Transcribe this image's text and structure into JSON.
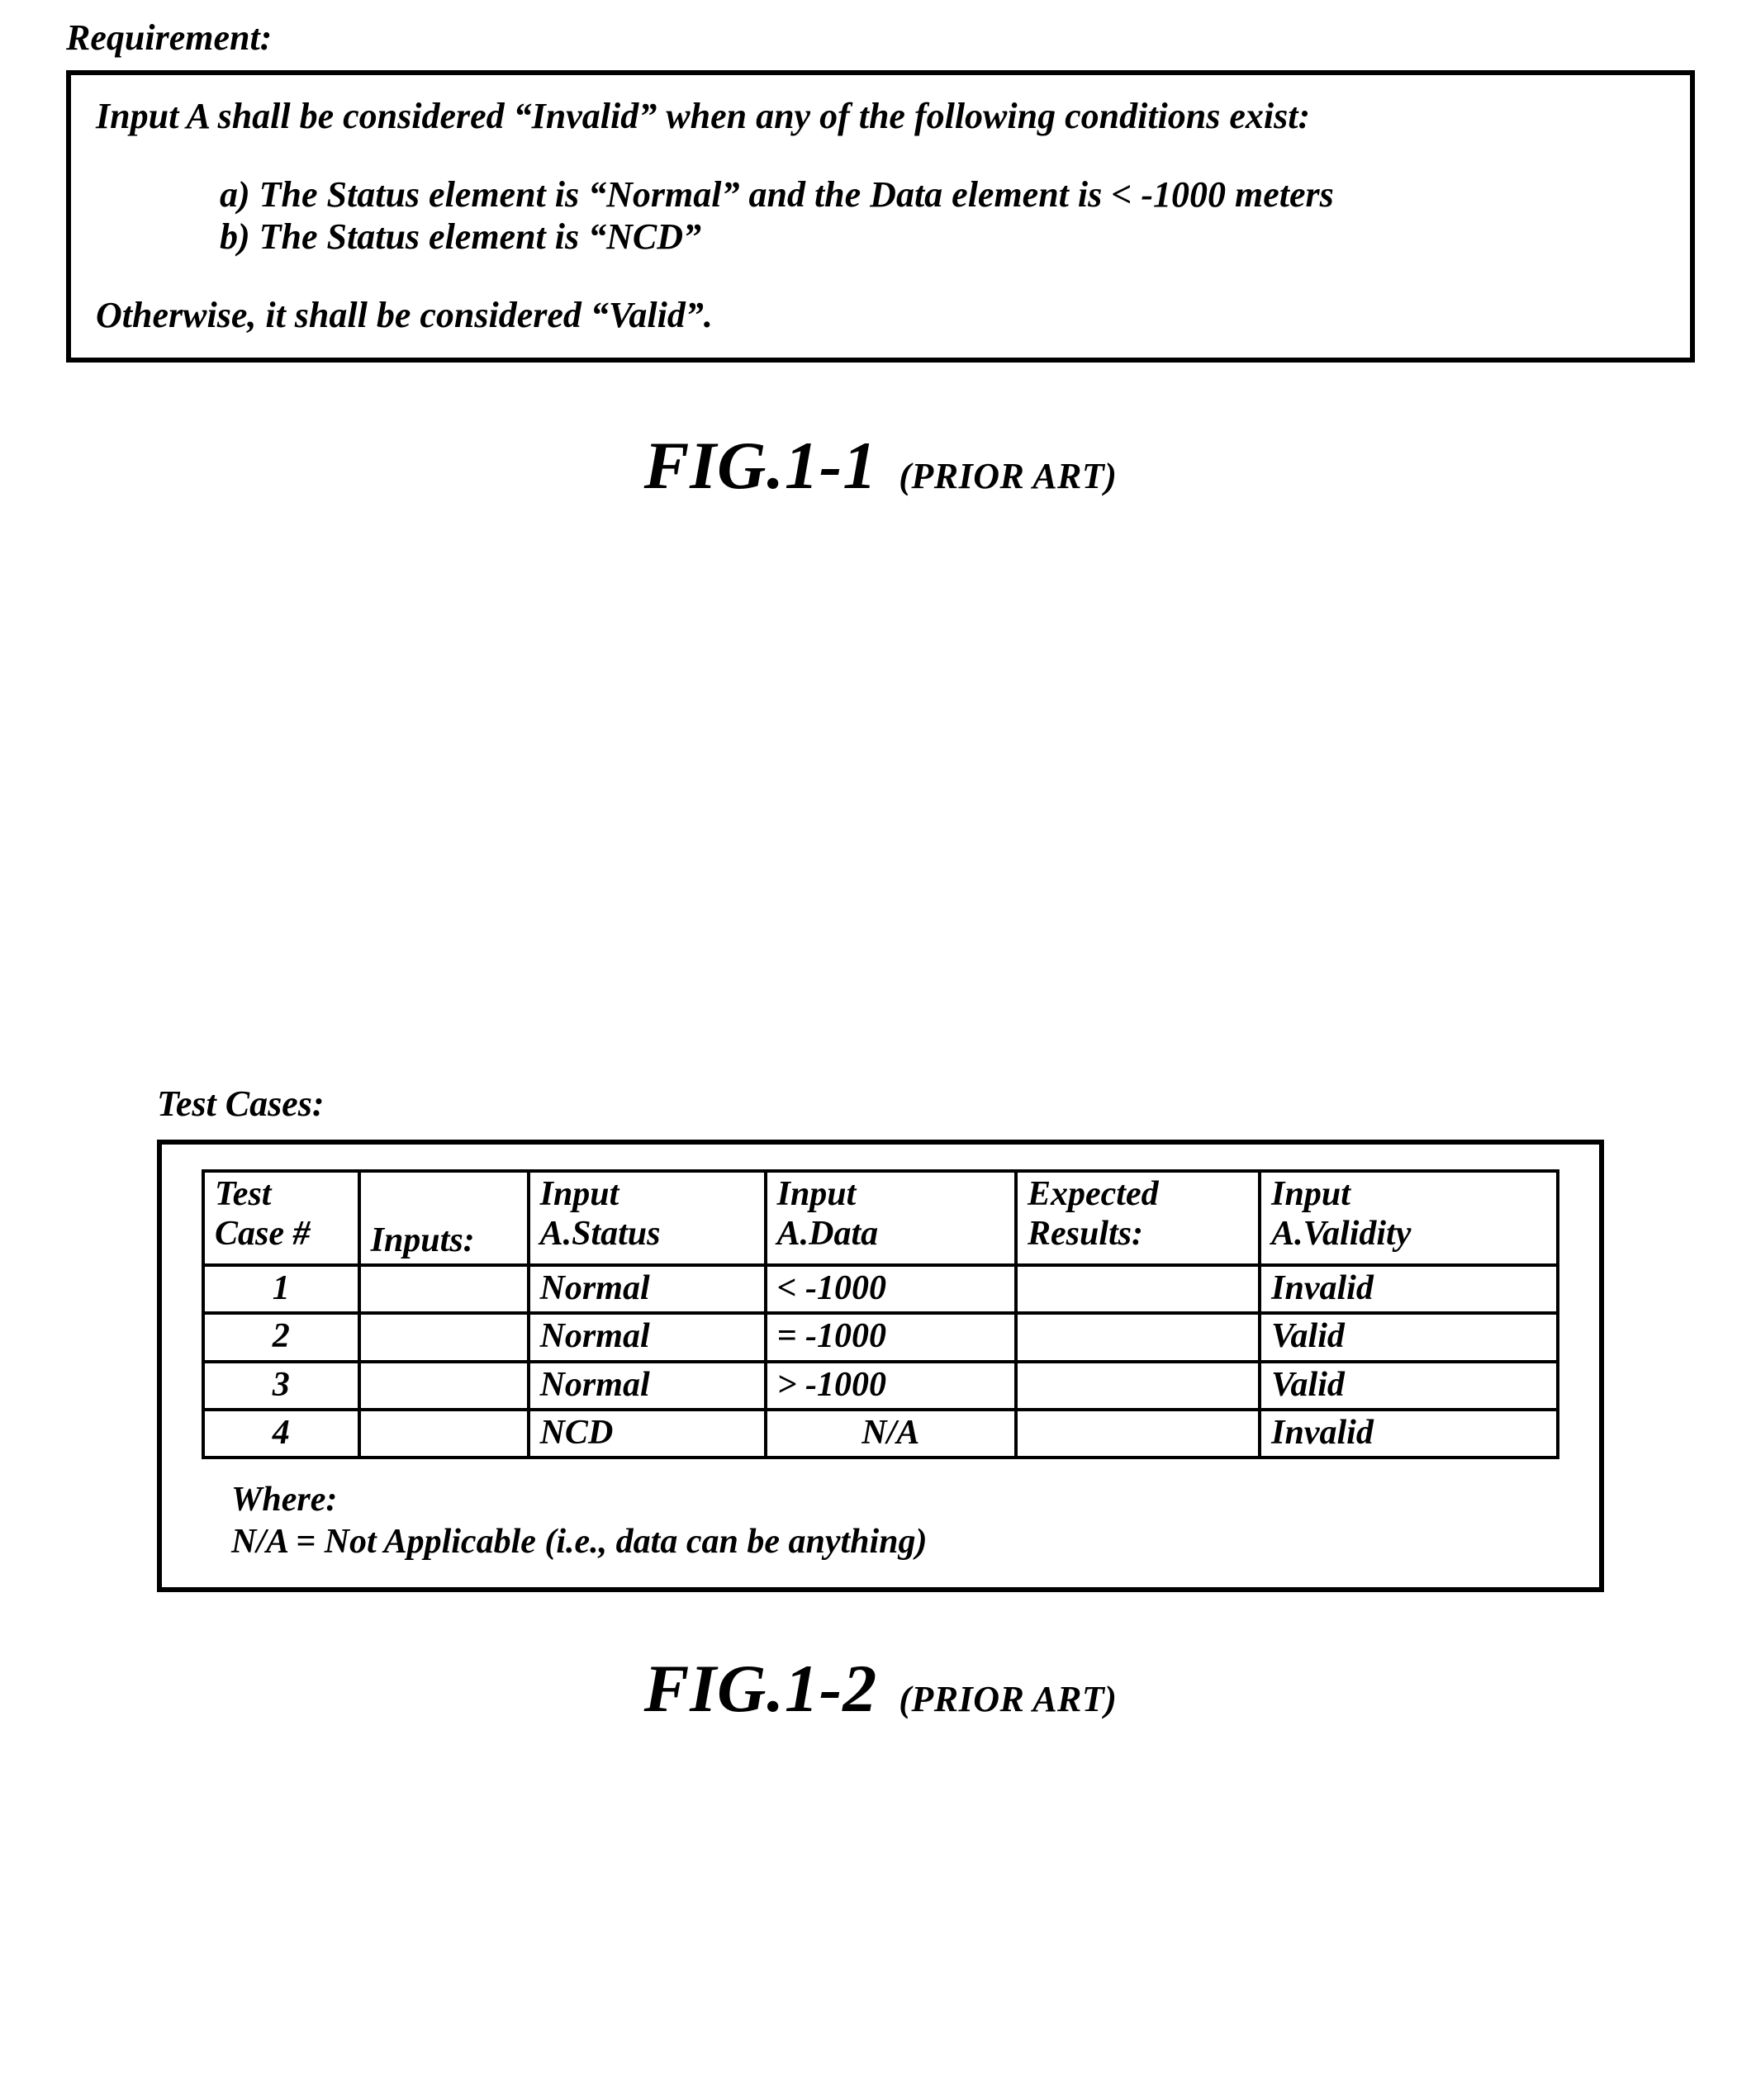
{
  "labels": {
    "requirement": "Requirement:",
    "test_cases": "Test Cases:"
  },
  "requirement": {
    "intro": "Input A shall be considered “Invalid” when any of the following conditions exist:",
    "a": "a) The Status element is “Normal” and the Data element is < -1000 meters",
    "b": "b) The Status element is “NCD”",
    "otherwise": "Otherwise, it shall be considered “Valid”."
  },
  "fig1": {
    "main": "FIG.1-1",
    "sub": "(PRIOR ART)"
  },
  "fig2": {
    "main": "FIG.1-2",
    "sub": "(PRIOR ART)"
  },
  "table": {
    "headers": {
      "h1a": "Test",
      "h1b": "Case #",
      "h2": "Inputs:",
      "h3a": "Input",
      "h3b": "A.Status",
      "h4a": "Input",
      "h4b": "A.Data",
      "h5a": "Expected",
      "h5b": "Results:",
      "h6a": "Input",
      "h6b": "A.Validity"
    },
    "rows": [
      {
        "case": "1",
        "inputs": "",
        "status": "Normal",
        "data": "< -1000",
        "exp": "",
        "validity": "Invalid"
      },
      {
        "case": "2",
        "inputs": "",
        "status": "Normal",
        "data": "= -1000",
        "exp": "",
        "validity": "Valid"
      },
      {
        "case": "3",
        "inputs": "",
        "status": "Normal",
        "data": "> -1000",
        "exp": "",
        "validity": "Valid"
      },
      {
        "case": "4",
        "inputs": "",
        "status": "NCD",
        "data": "N/A",
        "exp": "",
        "validity": "Invalid"
      }
    ]
  },
  "where": {
    "label": "Where:",
    "text": "N/A = Not Applicable (i.e., data can be anything)"
  }
}
